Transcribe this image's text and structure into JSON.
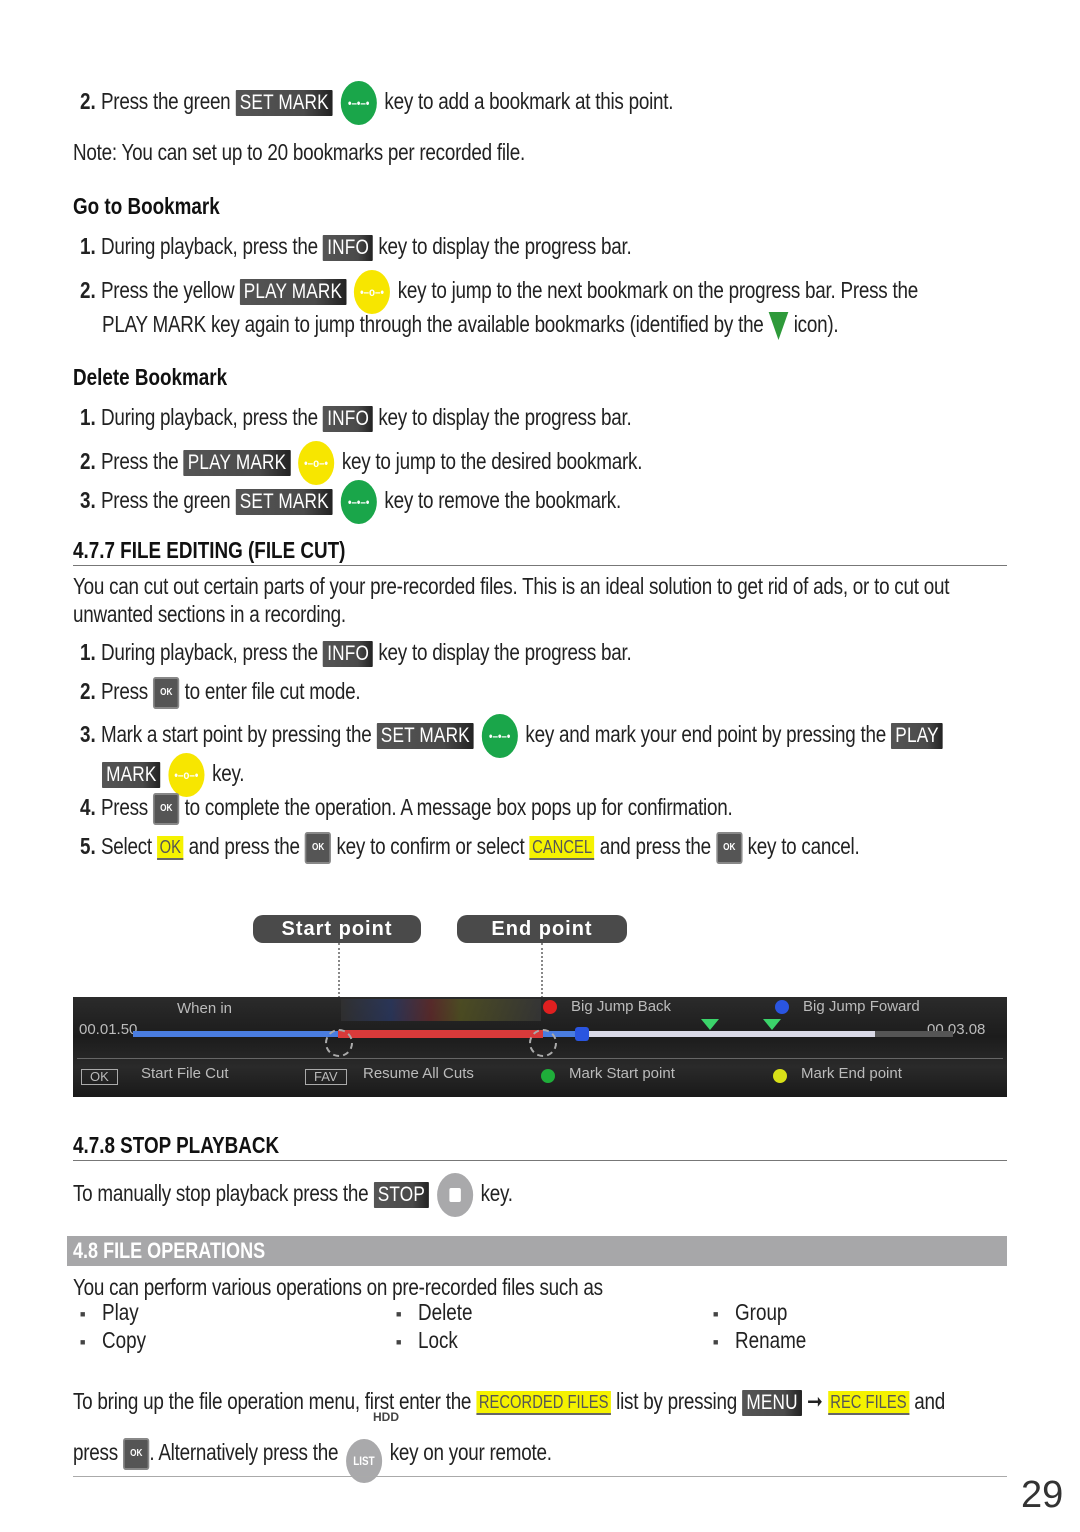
{
  "page_number": "29",
  "intro": {
    "step2": {
      "num": "2.",
      "pre": "Press the green",
      "key": "SET MARK",
      "key_icon": "set-mark-green-key",
      "post": "key to add a bookmark at this point."
    },
    "note": "Note: You can set up to 20 bookmarks per recorded file."
  },
  "go_to_bookmark": {
    "heading": "Go to Bookmark",
    "step1": {
      "num": "1.",
      "pre": "During playback, press the",
      "key": "INFO",
      "post": "key to display the progress bar."
    },
    "step2": {
      "num": "2.",
      "pre": "Press the yellow",
      "key": "PLAY MARK",
      "key_icon": "play-mark-yellow-key",
      "post": "key to jump to the next bookmark on the progress bar. Press the",
      "line2_pre": "PLAY MARK key again to jump through the available bookmarks (identified by the",
      "line2_icon": "bookmark-triangle-icon",
      "line2_post": "icon)."
    }
  },
  "delete_bookmark": {
    "heading": "Delete Bookmark",
    "step1": {
      "num": "1.",
      "pre": "During playback, press the",
      "key": "INFO",
      "post": "key to display the progress bar."
    },
    "step2": {
      "num": "2.",
      "pre": "Press the",
      "key": "PLAY MARK",
      "post": "key to jump to the desired bookmark."
    },
    "step3": {
      "num": "3.",
      "pre": "Press the green",
      "key": "SET MARK",
      "post": "key to remove the bookmark."
    }
  },
  "file_editing": {
    "heading": "4.7.7 FILE EDITING (FILE CUT)",
    "intro_line1": "You can cut out certain parts of your pre-recorded files. This is an ideal solution to get rid of ads, or to cut out",
    "intro_line2": "unwanted sections in a recording.",
    "step1": {
      "num": "1.",
      "pre": "During playback, press the",
      "key": "INFO",
      "post": "key to display the progress bar."
    },
    "step2": {
      "num": "2.",
      "pre": "Press",
      "ok": "OK",
      "post": "to enter file cut mode."
    },
    "step3": {
      "num": "3.",
      "pre": "Mark a start point by pressing the",
      "key": "SET MARK",
      "mid": "key and mark your end point by pressing the",
      "key2_a": "PLAY",
      "key2_b": "MARK",
      "post": "key."
    },
    "step4": {
      "num": "4.",
      "pre": "Press",
      "ok": "OK",
      "post": "to complete the operation. A message box pops up for confirmation."
    },
    "step5": {
      "num": "5.",
      "pre": "Select",
      "hl1": "OK",
      "mid1": "and press the",
      "ok": "OK",
      "mid2": "key to confirm or select",
      "hl2": "CANCEL",
      "mid3": "and press the",
      "post": "key to cancel."
    }
  },
  "screenshot": {
    "start_tag": "Start point",
    "end_tag": "End point",
    "when_in": "When in",
    "time_start": "00.01.50",
    "time_end": "00.03.08",
    "big_jump_back": "Big Jump Back",
    "big_jump_forward": "Big Jump Foward",
    "ok_box": "OK",
    "start_file_cut": "Start File Cut",
    "fav_box": "FAV",
    "resume_all_cuts": "Resume All Cuts",
    "mark_start_point": "Mark Start point",
    "mark_end_point": "Mark End point",
    "colors": {
      "red": "#e02020",
      "blue": "#2a55e0",
      "green": "#1fae3a",
      "yellow": "#d8e018"
    }
  },
  "stop_playback": {
    "heading": "4.7.8 STOP PLAYBACK",
    "pre": "To manually stop playback press the",
    "key": "STOP",
    "post": "key."
  },
  "file_operations": {
    "heading": "4.8 FILE OPERATIONS",
    "intro": "You can perform various operations on pre-recorded files such as",
    "operations": [
      "Play",
      "Delete",
      "Group",
      "Copy",
      "Lock",
      "Rename"
    ],
    "para_pre": "To bring up the file operation menu, first enter the",
    "hl_recorded": "RECORDED FILES",
    "para_mid": "list by pressing",
    "menu_key": "MENU",
    "arrow": "➞",
    "hl_rec": "REC FILES",
    "para_and": "and",
    "line2_pre": "press",
    "ok": "OK",
    "line2_mid": ". Alternatively press the",
    "hdd_label": "HDD",
    "list_key": "LIST",
    "line2_post": "key on your remote."
  },
  "colors": {
    "green_key": "#1aa64a",
    "yellow_key": "#f7e600",
    "highlight": "#f5f200",
    "banner": "#a7a7a9",
    "key_bg": "#4a4a4a"
  }
}
